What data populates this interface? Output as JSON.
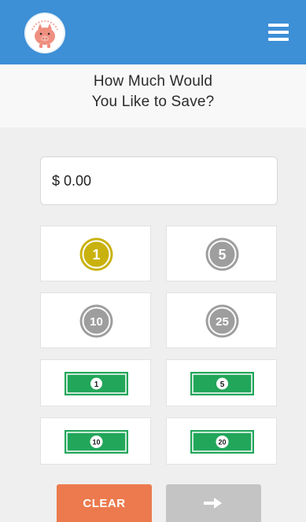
{
  "header": {
    "logo_icon": "piggy-bank-icon",
    "menu_icon": "hamburger-menu-icon",
    "bar_color": "#3d8fd6"
  },
  "prompt": {
    "line1": "How Much Would",
    "line2": "You Like to Save?"
  },
  "amount": {
    "value": "$ 0.00"
  },
  "denominations": {
    "coin_1": {
      "label": "1",
      "color": "#c9b20d"
    },
    "coin_5": {
      "label": "5",
      "color": "#9e9e9e"
    },
    "coin_10": {
      "label": "10",
      "color": "#9e9e9e"
    },
    "coin_25": {
      "label": "25",
      "color": "#9e9e9e"
    },
    "bill_1": {
      "label": "1",
      "color": "#22a65a"
    },
    "bill_5": {
      "label": "5",
      "color": "#22a65a"
    },
    "bill_10": {
      "label": "10",
      "color": "#22a65a"
    },
    "bill_20": {
      "label": "20",
      "color": "#22a65a"
    }
  },
  "actions": {
    "clear_label": "CLEAR",
    "clear_color": "#ec7a4e",
    "next_icon": "right-arrow-icon",
    "next_color": "#c4c4c4"
  }
}
